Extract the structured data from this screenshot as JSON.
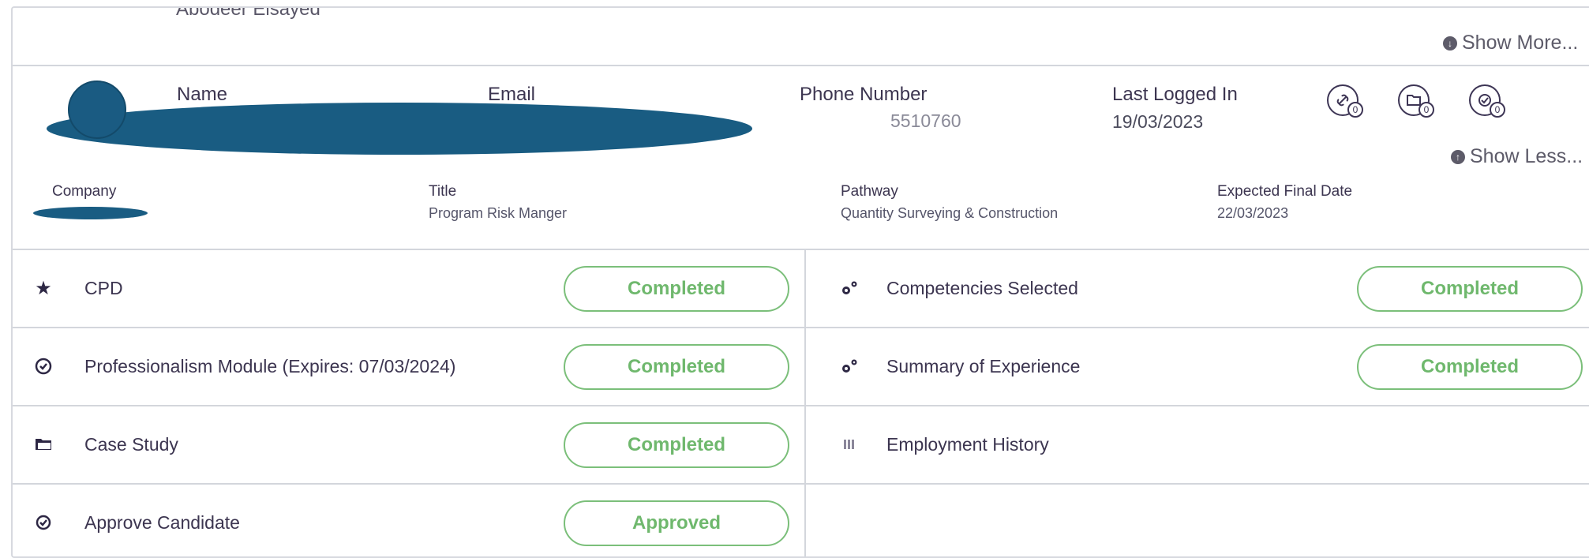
{
  "previous_candidate": {
    "name": "Abodeer Elsayed"
  },
  "header_show_more": "Show More...",
  "columns": {
    "name": "Name",
    "email": "Email",
    "phone": "Phone Number",
    "last_logged_in": "Last Logged In"
  },
  "candidate": {
    "phone_partial": "5510760",
    "last_logged_in": "19/03/2023"
  },
  "stats": [
    {
      "icon": "link-icon",
      "count": "0"
    },
    {
      "icon": "folder-icon",
      "count": "0"
    },
    {
      "icon": "check-icon",
      "count": "0"
    }
  ],
  "show_less": "Show Less...",
  "meta": {
    "company_label": "Company",
    "title_label": "Title",
    "title_value": "Program Risk Manger",
    "pathway_label": "Pathway",
    "pathway_value": "Quantity Surveying & Construction",
    "expected_date_label": "Expected Final Date",
    "expected_date_value": "22/03/2023"
  },
  "requirements_left": [
    {
      "icon": "star-icon",
      "label": "CPD",
      "status": "Completed"
    },
    {
      "icon": "clock-check-icon",
      "label": "Professionalism Module (Expires: 07/03/2024)",
      "status": "Completed"
    },
    {
      "icon": "folder-icon",
      "label": "Case Study",
      "status": "Completed"
    },
    {
      "icon": "check-circle-icon",
      "label": "Approve Candidate",
      "status": "Approved"
    }
  ],
  "requirements_right": [
    {
      "icon": "gears-icon",
      "label": "Competencies Selected",
      "status": "Completed"
    },
    {
      "icon": "gears-icon",
      "label": "Summary of Experience",
      "status": "Completed"
    },
    {
      "icon": "list-icon",
      "label": "Employment History",
      "status": ""
    }
  ],
  "colors": {
    "accent_green": "#6fb86d",
    "redaction_blue": "#195c82",
    "text_dark": "#3c3550"
  }
}
